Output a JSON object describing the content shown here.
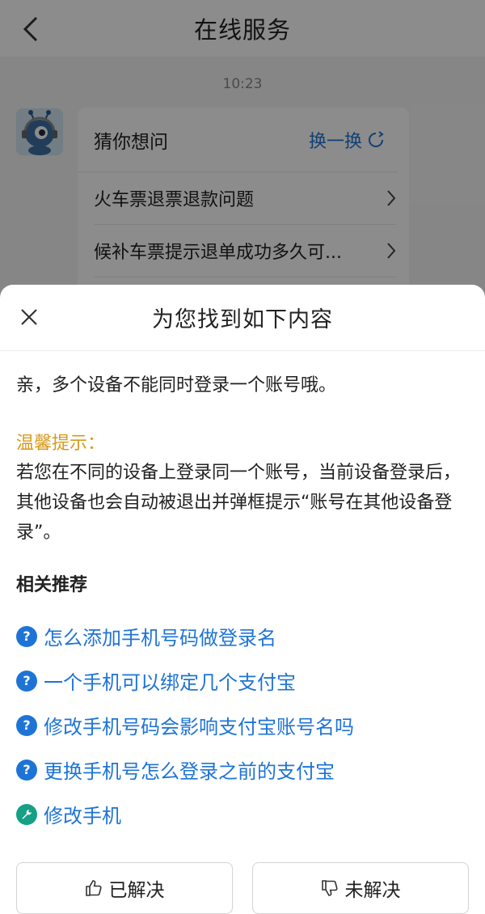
{
  "nav": {
    "title": "在线服务"
  },
  "chat": {
    "time": "10:23",
    "card": {
      "title": "猜你想问",
      "swap_label": "换一换",
      "items": [
        {
          "label": "火车票退票退款问题"
        },
        {
          "label": "候补车票提示退单成功多久可..."
        }
      ]
    }
  },
  "sheet": {
    "title": "为您找到如下内容",
    "answer": "亲，多个设备不能同时登录一个账号哦。",
    "tip_label": "温馨提示：",
    "tip_text": "若您在不同的设备上登录同一个账号，当前设备登录后，其他设备也会自动被退出并弹框提示“账号在其他设备登录”。",
    "recommend_title": "相关推荐",
    "recommendations": [
      {
        "label": "怎么添加手机号码做登录名",
        "icon": "question-icon"
      },
      {
        "label": "一个手机可以绑定几个支付宝",
        "icon": "question-icon"
      },
      {
        "label": "修改手机号码会影响支付宝账号名吗",
        "icon": "question-icon"
      },
      {
        "label": "更换手机号怎么登录之前的支付宝",
        "icon": "question-icon"
      },
      {
        "label": "修改手机",
        "icon": "wrench-icon"
      }
    ],
    "resolved_label": "已解决",
    "unresolved_label": "未解决"
  },
  "colors": {
    "accent": "#1e74d6",
    "tip": "#d69a1a",
    "tool": "#16a085"
  }
}
